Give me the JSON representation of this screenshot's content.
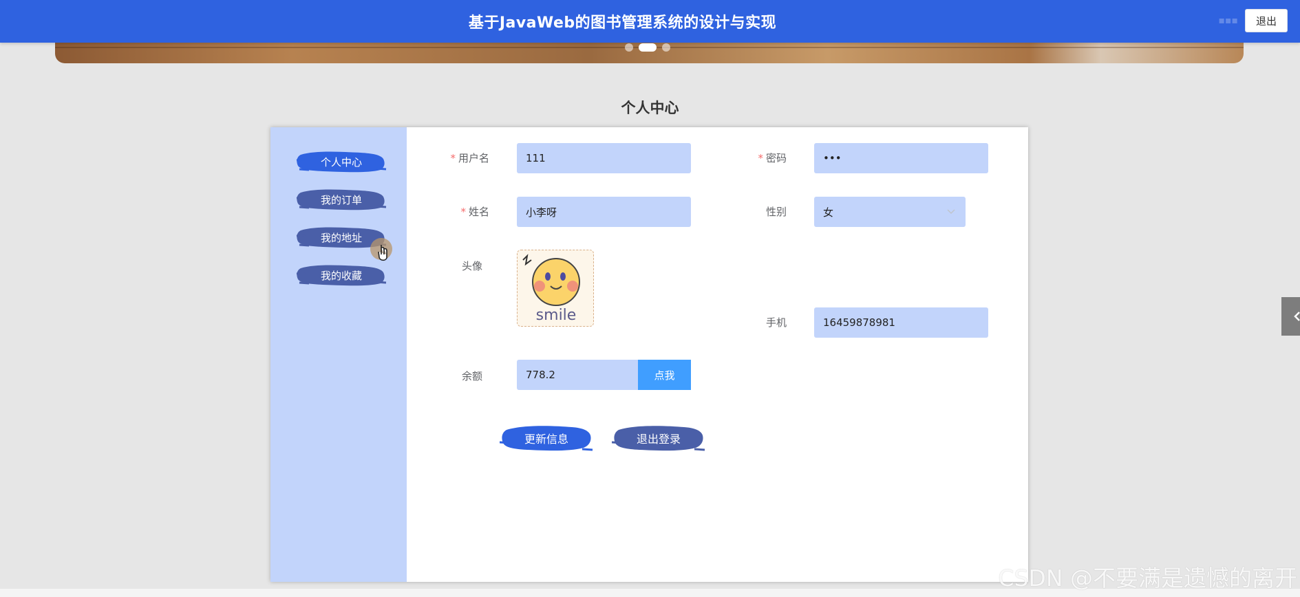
{
  "header": {
    "title": "基于JavaWeb的图书管理系统的设计与实现",
    "logout_label": "退出",
    "brand_color": "#2f62e0"
  },
  "carousel": {
    "slide_count": 3,
    "active_index": 1
  },
  "page": {
    "title": "个人中心"
  },
  "sidebar": {
    "items": [
      {
        "label": "个人中心",
        "active": true
      },
      {
        "label": "我的订单",
        "active": false
      },
      {
        "label": "我的地址",
        "active": false
      },
      {
        "label": "我的收藏",
        "active": false
      }
    ],
    "active_color": "#2f62e0",
    "inactive_color": "#4a5fa8"
  },
  "form": {
    "username": {
      "label": "用户名",
      "value": "111",
      "required": true
    },
    "password": {
      "label": "密码",
      "value": "•••",
      "required": true
    },
    "name": {
      "label": "姓名",
      "value": "小李呀",
      "required": true
    },
    "gender": {
      "label": "性别",
      "value": "女"
    },
    "avatar": {
      "label": "头像",
      "image_text": "smile"
    },
    "phone": {
      "label": "手机",
      "value": "16459878981"
    },
    "balance": {
      "label": "余额",
      "value": "778.2",
      "button_label": "点我"
    },
    "update_label": "更新信息",
    "logout_label": "退出登录"
  },
  "watermark": "CSDN @不要满是遗憾的离开"
}
